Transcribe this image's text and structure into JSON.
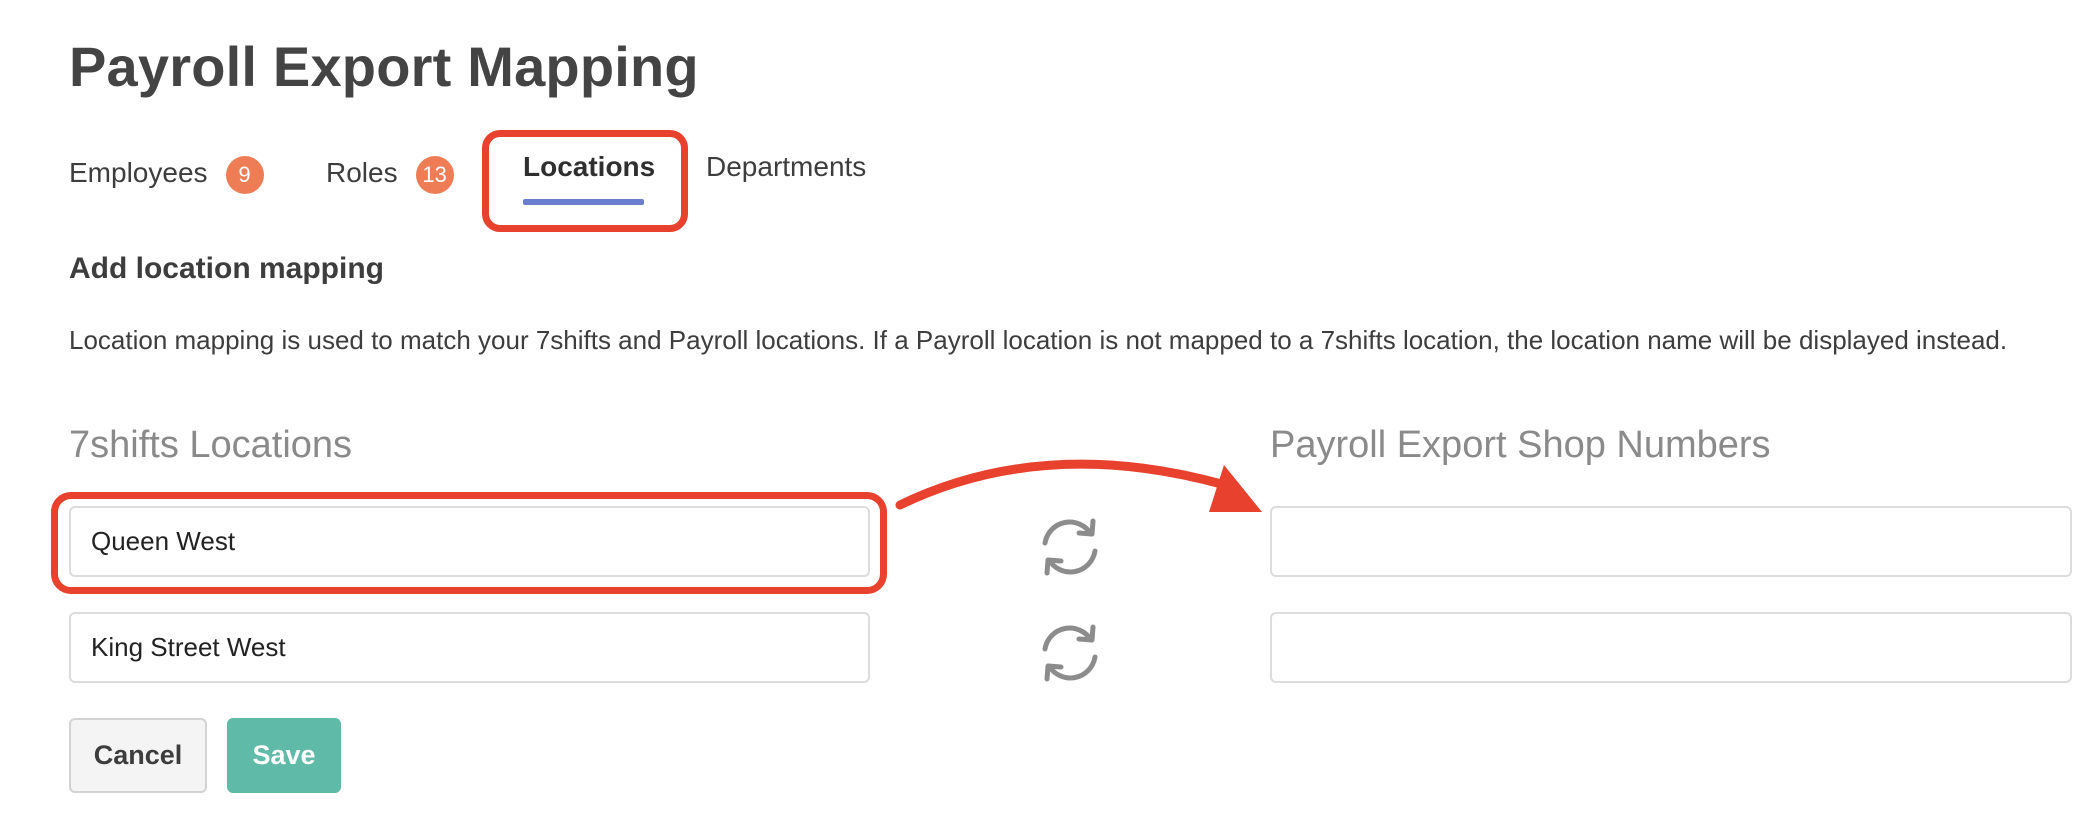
{
  "page": {
    "title": "Payroll Export Mapping"
  },
  "tabs": [
    {
      "label": "Employees",
      "badge": "9"
    },
    {
      "label": "Roles",
      "badge": "13"
    },
    {
      "label": "Locations",
      "active": true
    },
    {
      "label": "Departments"
    }
  ],
  "section": {
    "heading": "Add location mapping",
    "description": "Location mapping is used to match your 7shifts and Payroll locations. If a Payroll location is not mapped to a 7shifts location, the location name will be displayed instead."
  },
  "columns": {
    "left_title": "7shifts Locations",
    "right_title": "Payroll Export Shop Numbers"
  },
  "rows": [
    {
      "location": "Queen West",
      "shop_number": ""
    },
    {
      "location": "King Street West",
      "shop_number": ""
    }
  ],
  "buttons": {
    "cancel": "Cancel",
    "save": "Save"
  },
  "icons": {
    "sync": "sync-icon",
    "annotation_arrow": "arrow-icon"
  },
  "colors": {
    "badge": "#ee7d55",
    "active_tab_underline": "#6b7fd0",
    "annotation": "#e8412d",
    "save_button": "#5fbaa7",
    "column_title": "#8a8a8a"
  }
}
